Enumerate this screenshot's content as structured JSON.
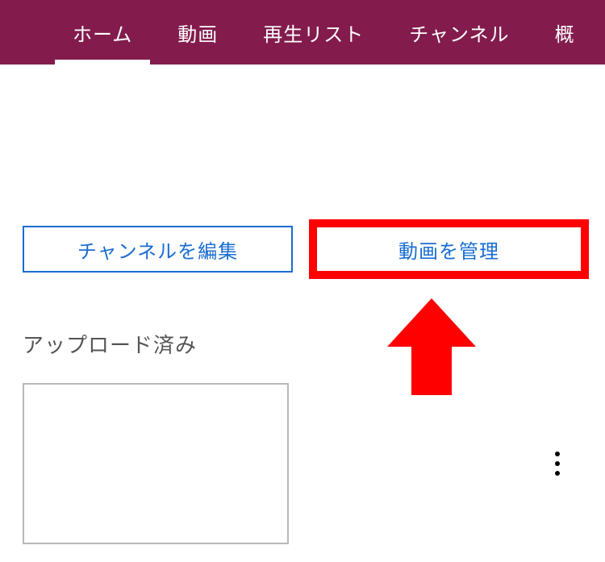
{
  "nav": {
    "items": [
      {
        "label": "ホーム",
        "active": true
      },
      {
        "label": "動画",
        "active": false
      },
      {
        "label": "再生リスト",
        "active": false
      },
      {
        "label": "チャンネル",
        "active": false
      },
      {
        "label": "概",
        "active": false
      }
    ]
  },
  "buttons": {
    "edit_channel": "チャンネルを編集",
    "manage_videos": "動画を管理"
  },
  "section": {
    "uploaded_title": "アップロード済み"
  },
  "annotation": {
    "highlight_color": "#ff0000"
  }
}
